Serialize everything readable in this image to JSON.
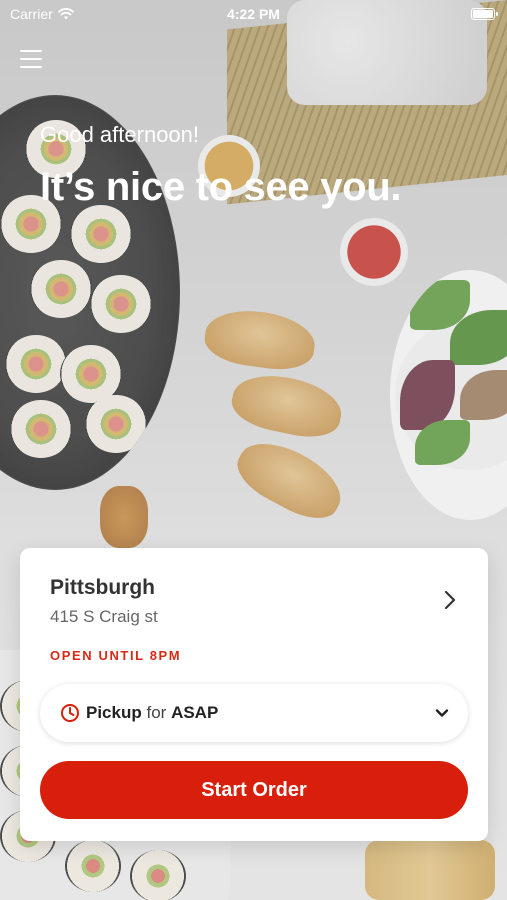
{
  "status_bar": {
    "carrier": "Carrier",
    "time": "4:22 PM"
  },
  "header": {
    "menu_icon": "hamburger-icon"
  },
  "greeting": {
    "subtitle": "Good afternoon!",
    "title": "It’s nice to see you."
  },
  "location_card": {
    "name": "Pittsburgh",
    "address": "415 S Craig st",
    "hours": "OPEN UNTIL 8PM",
    "chevron_icon": "chevron-right-icon",
    "order_mode": {
      "icon": "clock-icon",
      "type": "Pickup",
      "connector": "for",
      "time": "ASAP",
      "caret_icon": "chevron-down-icon"
    },
    "cta": "Start Order"
  },
  "colors": {
    "accent": "#d81f0c",
    "hours_text": "#d92a17"
  }
}
